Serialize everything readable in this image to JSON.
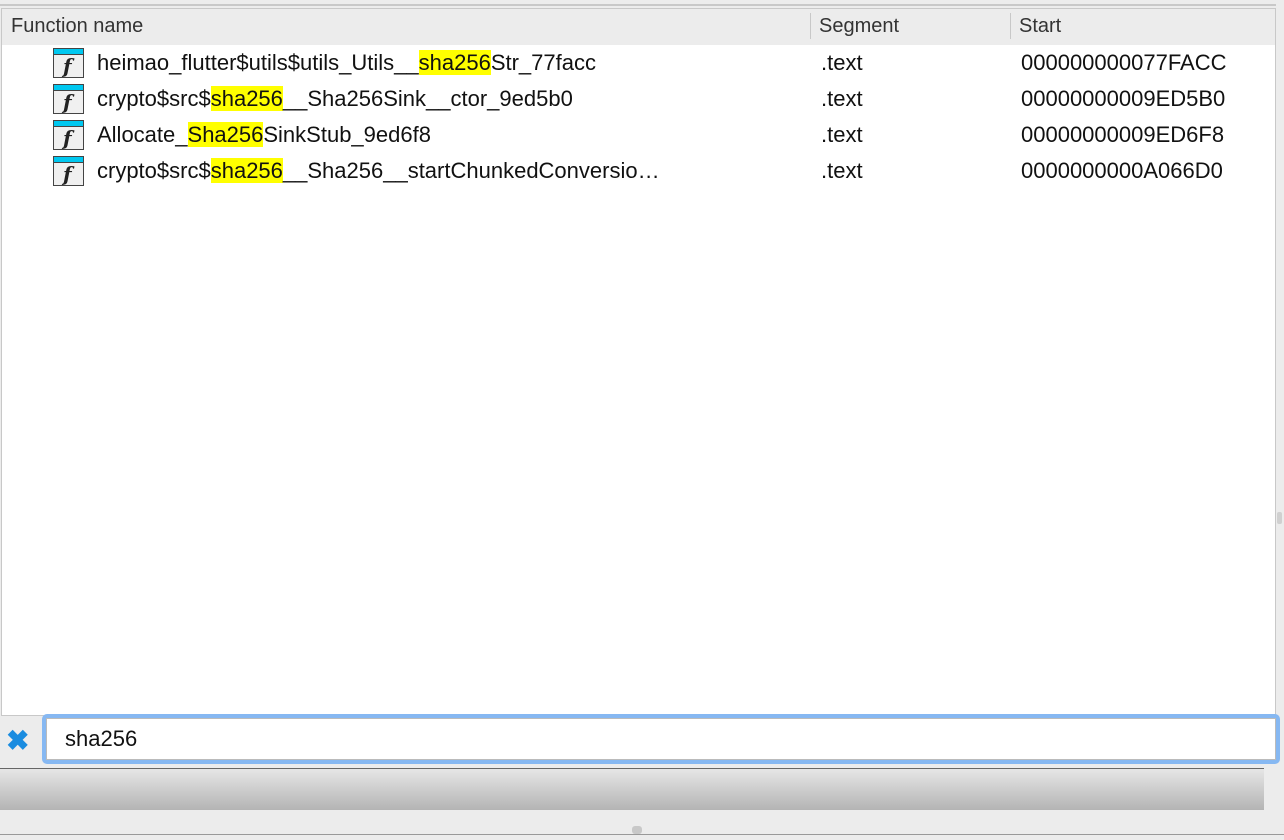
{
  "columns": {
    "name": "Function name",
    "segment": "Segment",
    "start": "Start"
  },
  "rows": [
    {
      "pre": "heimao_flutter$utils$utils_Utils__",
      "match": "sha256",
      "post": "Str_77facc",
      "segment": ".text",
      "start": "000000000077FACC"
    },
    {
      "pre": "crypto$src$",
      "match": "sha256",
      "post": "__Sha256Sink__ctor_9ed5b0",
      "segment": ".text",
      "start": "00000000009ED5B0"
    },
    {
      "pre": "Allocate_",
      "match": "Sha256",
      "post": "SinkStub_9ed6f8",
      "segment": ".text",
      "start": "00000000009ED6F8"
    },
    {
      "pre": "crypto$src$",
      "match": "sha256",
      "post": "__Sha256__startChunkedConversio…",
      "segment": ".text",
      "start": "0000000000A066D0"
    }
  ],
  "search": {
    "value": "sha256"
  },
  "icons": {
    "function": "function-icon",
    "clear": "clear-icon"
  }
}
